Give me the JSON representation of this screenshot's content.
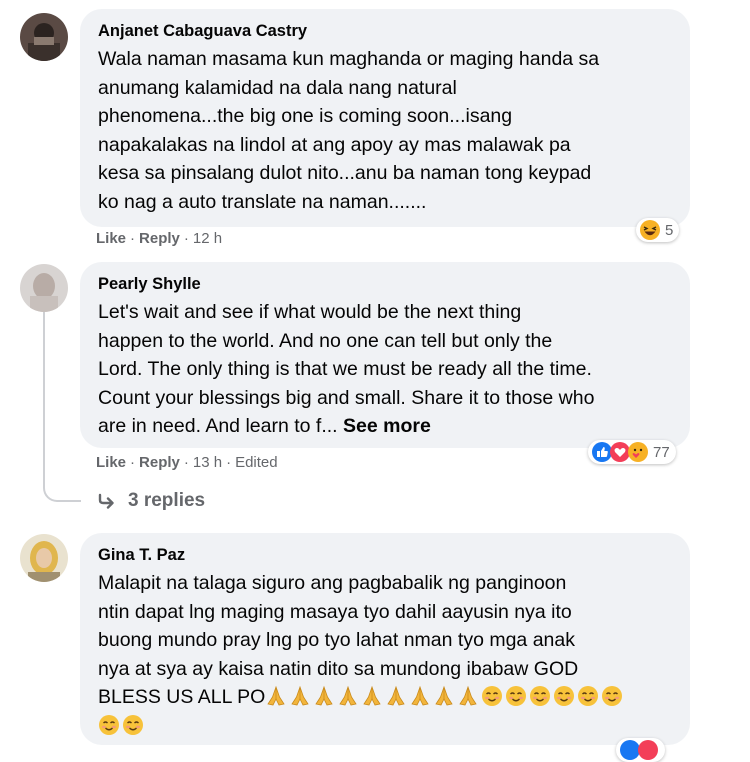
{
  "comments": [
    {
      "author": "Anjanet Cabaguava Castry",
      "text": "Wala naman masama kun maghanda or maging handa sa\nanumang kalamidad na dala nang natural\nphenomena...the big one is coming soon...isang\nnapakalakas na lindol at ang apoy ay mas malawak pa\nkesa sa pinsalang dulot nito...anu ba naman tong keypad\nko nag a auto translate na naman.......",
      "like_label": "Like",
      "reply_label": "Reply",
      "time": "12 h",
      "reaction_count": "5",
      "reaction_icons": [
        "haha-icon"
      ]
    },
    {
      "author": "Pearly Shylle",
      "text": "Let's wait and see if what would be the next thing\nhappen to the world. And no one can tell but only the\nLord. The only thing is that we must be ready all the time.\nCount your blessings big and small. Share it to those who\nare in need. And learn to f... ",
      "see_more": "See more",
      "like_label": "Like",
      "reply_label": "Reply",
      "time": "13 h",
      "edited": "Edited",
      "reaction_count": "77",
      "reaction_icons": [
        "like-icon",
        "love-icon",
        "care-icon"
      ],
      "replies_label": "3 replies"
    },
    {
      "author": "Gina T. Paz",
      "text_line1": "Malapit na talaga siguro ang pagbabalik ng panginoon",
      "text_line2": "ntin dapat lng maging masaya tyo dahil aayusin nya ito",
      "text_line3": "buong mundo pray lng po tyo lahat nman tyo mga anak",
      "text_line4": "nya at sya ay kaisa natin dito sa mundong ibabaw GOD",
      "text_line5": "BLESS US ALL PO",
      "emoji_pray_count": 9,
      "emoji_smile_count_line5": 6,
      "emoji_smile_count_line6": 2,
      "emoji_names": [
        "folded-hands-icon",
        "smiling-face-icon"
      ]
    }
  ],
  "colors": {
    "bubble": "#f0f2f5",
    "meta": "#65676b",
    "like_blue": "#1877f2",
    "love_red": "#f33e58",
    "haha_yellow": "#f7b125"
  }
}
